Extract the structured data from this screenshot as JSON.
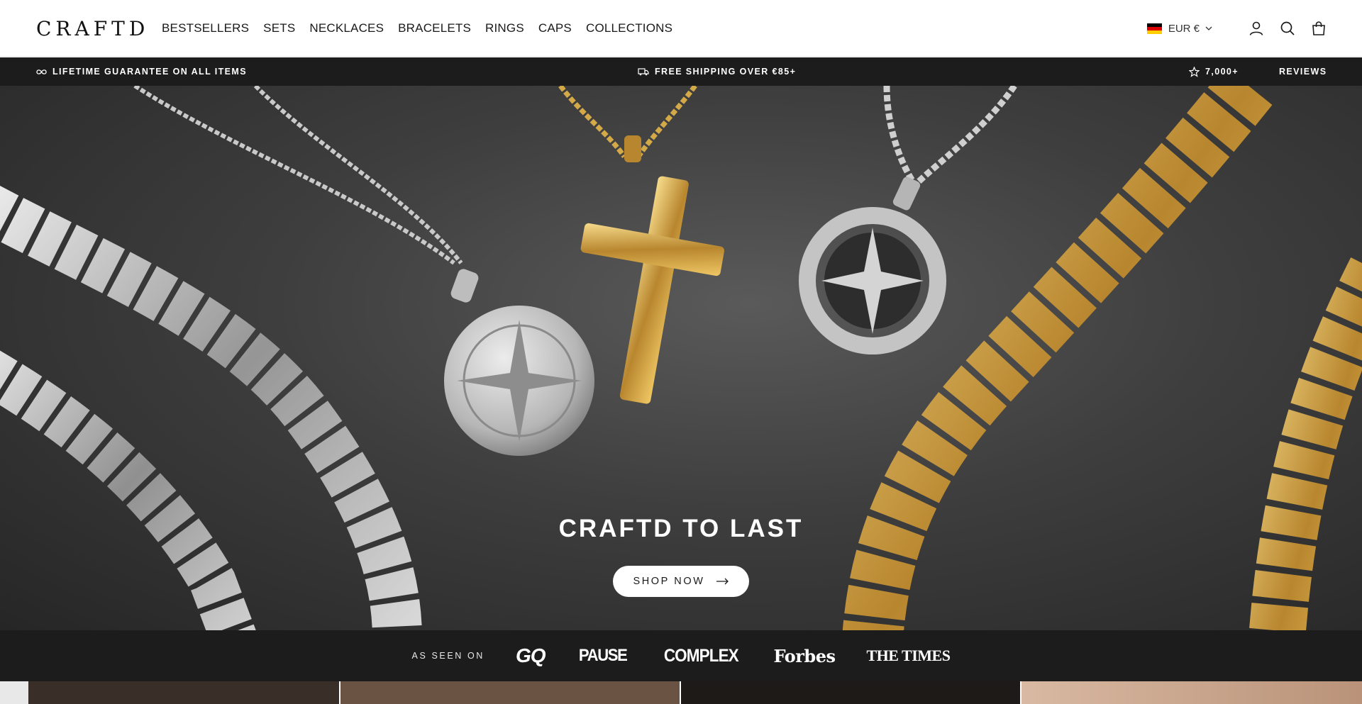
{
  "header": {
    "logo": "CRAFTD",
    "nav": [
      "BESTSELLERS",
      "SETS",
      "NECKLACES",
      "BRACELETS",
      "RINGS",
      "CAPS",
      "COLLECTIONS"
    ],
    "currency": "EUR €",
    "icons": [
      "germany-flag-icon",
      "chevron-down-icon",
      "account-icon",
      "search-icon",
      "cart-icon"
    ]
  },
  "announcement": {
    "guarantee": "LIFETIME GUARANTEE ON ALL ITEMS",
    "shipping": "FREE SHIPPING OVER €85+",
    "reviews_count": "7,000+",
    "reviews_label": "REVIEWS"
  },
  "hero": {
    "title": "CRAFTD TO LAST",
    "button": "SHOP NOW"
  },
  "press": {
    "label": "AS SEEN ON",
    "logos": [
      "GQ",
      "PAUSE",
      "COMPLEX",
      "Forbes",
      "THE TIMES"
    ]
  },
  "colors": {
    "dark_bar": "#1c1c1c",
    "gold": "#c9a24a",
    "silver": "#c8c8c8"
  }
}
